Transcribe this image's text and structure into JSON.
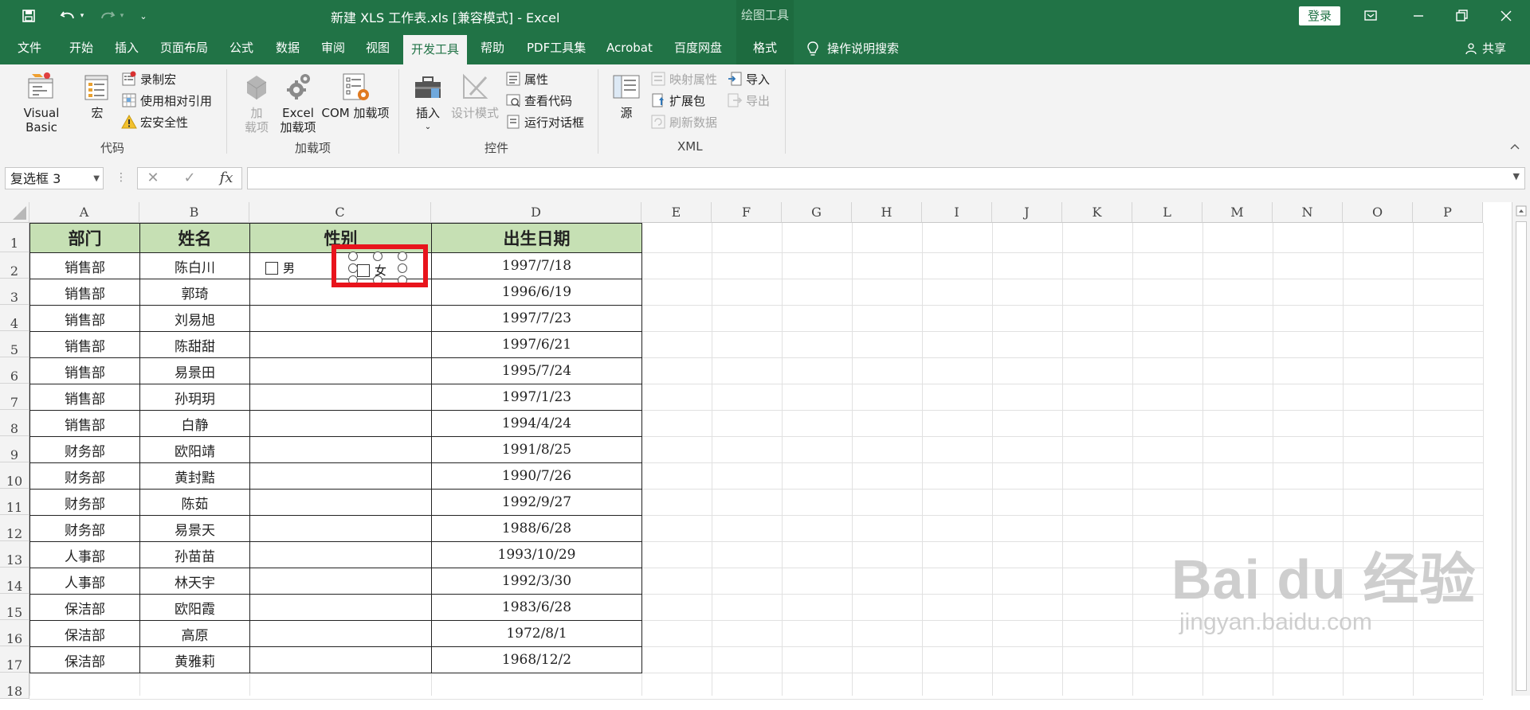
{
  "titlebar": {
    "title": "新建 XLS 工作表.xls  [兼容模式]  -  Excel",
    "context_label": "绘图工具",
    "login_label": "登录"
  },
  "tabs": [
    {
      "label": "文件"
    },
    {
      "label": "开始"
    },
    {
      "label": "插入"
    },
    {
      "label": "页面布局"
    },
    {
      "label": "公式"
    },
    {
      "label": "数据"
    },
    {
      "label": "审阅"
    },
    {
      "label": "视图"
    },
    {
      "label": "开发工具"
    },
    {
      "label": "帮助"
    },
    {
      "label": "PDF工具集"
    },
    {
      "label": "Acrobat"
    },
    {
      "label": "百度网盘"
    },
    {
      "label": "格式"
    }
  ],
  "tell_me": "操作说明搜索",
  "share": "共享",
  "ribbon": {
    "code": {
      "group_label": "代码",
      "visual_basic": "Visual Basic",
      "macros": "宏",
      "record_macro": "录制宏",
      "use_relative": "使用相对引用",
      "macro_security": "宏安全性"
    },
    "addins": {
      "group_label": "加载项",
      "addins_line1": "加",
      "addins_line2": "载项",
      "excel_addins_line1": "Excel",
      "excel_addins_line2": "加载项",
      "com_addins": "COM 加载项"
    },
    "controls": {
      "group_label": "控件",
      "insert": "插入",
      "design_mode": "设计模式",
      "properties": "属性",
      "view_code": "查看代码",
      "run_dialog": "运行对话框"
    },
    "xml": {
      "group_label": "XML",
      "source": "源",
      "map_properties": "映射属性",
      "expansion_packs": "扩展包",
      "refresh_data": "刷新数据",
      "import": "导入",
      "export": "导出"
    }
  },
  "formula_bar": {
    "name_box": "复选框 3",
    "fx": "fx",
    "cancel": "✕",
    "enter": "✓",
    "value": ""
  },
  "columns": [
    "A",
    "B",
    "C",
    "D",
    "E",
    "F",
    "G",
    "H",
    "I",
    "J",
    "K",
    "L",
    "M",
    "N",
    "O",
    "P"
  ],
  "rows": [
    "1",
    "2",
    "3",
    "4",
    "5",
    "6",
    "7",
    "8",
    "9",
    "10",
    "11",
    "12",
    "13",
    "14",
    "15",
    "16",
    "17",
    "18"
  ],
  "table": {
    "headers": [
      "部门",
      "姓名",
      "性别",
      "出生日期"
    ],
    "data": [
      [
        "销售部",
        "陈白川",
        "",
        "1997/7/18"
      ],
      [
        "销售部",
        "郭琦",
        "",
        "1996/6/19"
      ],
      [
        "销售部",
        "刘易旭",
        "",
        "1997/7/23"
      ],
      [
        "销售部",
        "陈甜甜",
        "",
        "1997/6/21"
      ],
      [
        "销售部",
        "易景田",
        "",
        "1995/7/24"
      ],
      [
        "销售部",
        "孙玥玥",
        "",
        "1997/1/23"
      ],
      [
        "销售部",
        "白静",
        "",
        "1994/4/24"
      ],
      [
        "财务部",
        "欧阳靖",
        "",
        "1991/8/25"
      ],
      [
        "财务部",
        "黄封黠",
        "",
        "1990/7/26"
      ],
      [
        "财务部",
        "陈茹",
        "",
        "1992/9/27"
      ],
      [
        "财务部",
        "易景天",
        "",
        "1988/6/28"
      ],
      [
        "人事部",
        "孙苗苗",
        "",
        "1993/10/29"
      ],
      [
        "人事部",
        "林天宇",
        "",
        "1992/3/30"
      ],
      [
        "保洁部",
        "欧阳霞",
        "",
        "1983/6/28"
      ],
      [
        "保洁部",
        "高原",
        "",
        "1972/8/1"
      ],
      [
        "保洁部",
        "黄雅莉",
        "",
        "1968/12/2"
      ]
    ]
  },
  "checkboxes": {
    "male": "男",
    "female": "女"
  },
  "watermark": {
    "logo": "Bai du 经验",
    "url": "jingyan.baidu.com"
  }
}
